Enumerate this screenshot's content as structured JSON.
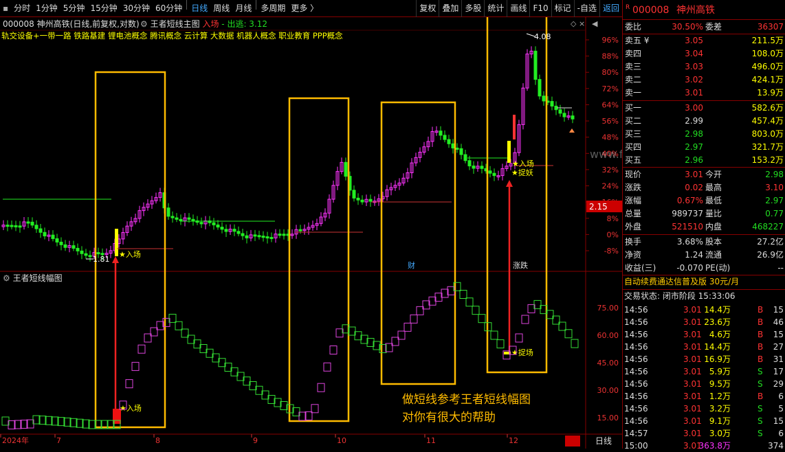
{
  "toolbar": {
    "periods": [
      "分时",
      "1分钟",
      "5分钟",
      "15分钟",
      "30分钟",
      "60分钟",
      "日线",
      "周线",
      "月线",
      "多周期",
      "更多 〉"
    ],
    "active": "日线",
    "right": [
      "复权",
      "叠加",
      "多股",
      "统计",
      "画线",
      "F10",
      "标记",
      "-自选",
      "返回"
    ]
  },
  "stock": {
    "code": "000008",
    "name": "神州高铁",
    "mode": "(日线,前复权,对数)",
    "indicator": "王者短线主图",
    "entry": "入场",
    "exit_label": "出逃: 3.12",
    "concepts": "轨交设备+一带一路 铁路基建 锂电池概念 腾讯概念 云计算 大数据 机器人概念 职业教育 PPP概念"
  },
  "main_axis": {
    "labels": [
      "96%",
      "88%",
      "80%",
      "72%",
      "64%",
      "56%",
      "48%",
      "40%",
      "32%",
      "24%",
      "16%",
      "8%",
      "0%",
      "-8%"
    ],
    "current": "2.15"
  },
  "sub": {
    "title": "王者短线幅图",
    "axis": [
      "75.00",
      "60.00",
      "45.00",
      "30.00",
      "15.00"
    ]
  },
  "dates": {
    "labels": [
      "2024年",
      "7",
      "8",
      "9",
      "10",
      "11",
      "12"
    ],
    "period": "日线"
  },
  "annotations": {
    "high": "4.08",
    "low": "1.81",
    "entry1": "★入场",
    "entry2": "★入场",
    "entry3": "★入场",
    "catch1": "★捉妖",
    "catch2": "★捉场",
    "cai": "财",
    "zhangdie": "涨跌",
    "note1": "做短线参考王者短线幅图",
    "note2": "对你有很大的帮助",
    "watermark": "www.fxichi.com"
  },
  "panel": {
    "header": {
      "code": "000008",
      "name": "神州高铁",
      "badge": "R"
    },
    "weibi": {
      "l1": "委比",
      "v1": "30.50%",
      "l2": "委差",
      "v2": "36307"
    },
    "sells": [
      {
        "l": "卖五 ¥",
        "p": "3.05",
        "v": "211.5万"
      },
      {
        "l": "卖四",
        "p": "3.04",
        "v": "108.0万"
      },
      {
        "l": "卖三",
        "p": "3.03",
        "v": "496.0万"
      },
      {
        "l": "卖二",
        "p": "3.02",
        "v": "424.1万"
      },
      {
        "l": "卖一",
        "p": "3.01",
        "v": "13.9万"
      }
    ],
    "buys": [
      {
        "l": "买一",
        "p": "3.00",
        "v": "582.6万"
      },
      {
        "l": "买二",
        "p": "2.99",
        "v": "457.4万"
      },
      {
        "l": "买三",
        "p": "2.98",
        "v": "803.0万"
      },
      {
        "l": "买四",
        "p": "2.97",
        "v": "321.7万"
      },
      {
        "l": "买五",
        "p": "2.96",
        "v": "153.2万"
      }
    ],
    "quote": [
      {
        "l1": "现价",
        "v1": "3.01",
        "c1": "red",
        "l2": "今开",
        "v2": "2.98",
        "c2": "grn"
      },
      {
        "l1": "涨跌",
        "v1": "0.02",
        "c1": "red",
        "l2": "最高",
        "v2": "3.10",
        "c2": "red"
      },
      {
        "l1": "涨幅",
        "v1": "0.67%",
        "c1": "red",
        "l2": "最低",
        "v2": "2.97",
        "c2": "grn"
      },
      {
        "l1": "总量",
        "v1": "989737",
        "c1": "wht",
        "l2": "量比",
        "v2": "0.77",
        "c2": "grn"
      },
      {
        "l1": "外盘",
        "v1": "521510",
        "c1": "red",
        "l2": "内盘",
        "v2": "468227",
        "c2": "grn"
      }
    ],
    "stats": [
      {
        "l1": "换手",
        "v1": "3.68%",
        "l2": "股本",
        "v2": "27.2亿"
      },
      {
        "l1": "净资",
        "v1": "1.24",
        "l2": "流通",
        "v2": "26.9亿"
      },
      {
        "l1": "收益(三)",
        "v1": "-0.070",
        "l2": "PE(动)",
        "v2": "--"
      }
    ],
    "promo": "自动续费通达信普及版  30元/月",
    "trade_status": "交易状态: 闭市阶段 15:33:06",
    "ticks": [
      {
        "t": "14:56",
        "p": "3.01",
        "v": "14.4万",
        "d": "B",
        "n": "15"
      },
      {
        "t": "14:56",
        "p": "3.01",
        "v": "23.6万",
        "d": "B",
        "n": "46"
      },
      {
        "t": "14:56",
        "p": "3.01",
        "v": "4.6万",
        "d": "B",
        "n": "15"
      },
      {
        "t": "14:56",
        "p": "3.01",
        "v": "14.4万",
        "d": "B",
        "n": "27"
      },
      {
        "t": "14:56",
        "p": "3.01",
        "v": "16.9万",
        "d": "B",
        "n": "31"
      },
      {
        "t": "14:56",
        "p": "3.01",
        "v": "5.9万",
        "d": "S",
        "n": "17"
      },
      {
        "t": "14:56",
        "p": "3.01",
        "v": "9.5万",
        "d": "S",
        "n": "29"
      },
      {
        "t": "14:56",
        "p": "3.01",
        "v": "1.2万",
        "d": "B",
        "n": "6"
      },
      {
        "t": "14:56",
        "p": "3.01",
        "v": "3.2万",
        "d": "S",
        "n": "5"
      },
      {
        "t": "14:56",
        "p": "3.01",
        "v": "9.1万",
        "d": "S",
        "n": "15"
      },
      {
        "t": "14:57",
        "p": "3.01",
        "v": "3.0万",
        "d": "S",
        "n": "6"
      },
      {
        "t": "15:00",
        "p": "3.01",
        "v": "363.8万",
        "d": "",
        "n": "374"
      }
    ]
  }
}
